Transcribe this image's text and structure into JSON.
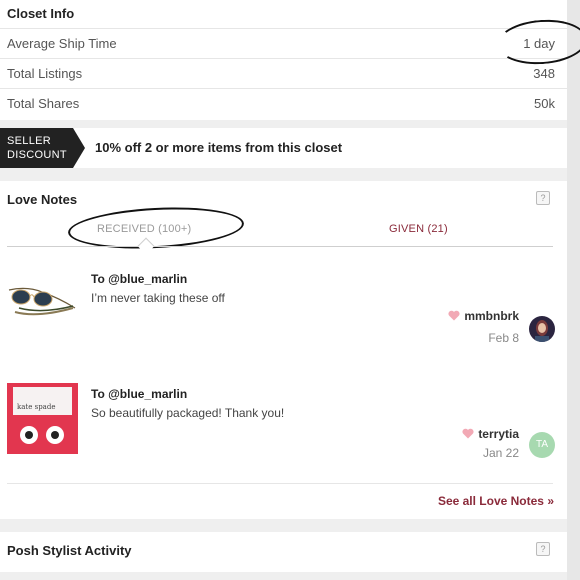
{
  "closet_info": {
    "title": "Closet Info",
    "rows": [
      {
        "label": "Average Ship Time",
        "value": "1 day"
      },
      {
        "label": "Total Listings",
        "value": "348"
      },
      {
        "label": "Total Shares",
        "value": "50k"
      }
    ]
  },
  "discount": {
    "badge_line1": "SELLER",
    "badge_line2": "DISCOUNT",
    "text": "10% off 2 or more items from this closet"
  },
  "love_notes": {
    "title": "Love Notes",
    "help": "?",
    "tabs": [
      {
        "label": "RECEIVED (100+)",
        "active": true
      },
      {
        "label": "GIVEN (21)",
        "active": false
      }
    ],
    "notes": [
      {
        "to": "To @blue_marlin",
        "message": "I’m never taking these off",
        "user": "mmbnbrk",
        "date": "Feb 8",
        "thumb_icon": "sunglasses-thumbnail"
      },
      {
        "to": "To @blue_marlin",
        "message": "So beautifully packaged! Thank you!",
        "user": "terrytia",
        "date": "Jan 22",
        "avatar_initials": "TA",
        "thumb_icon": "earrings-thumbnail"
      }
    ],
    "see_all": "See all Love Notes »"
  },
  "posh_stylist": {
    "title": "Posh Stylist Activity",
    "help": "?"
  },
  "colors": {
    "accent": "#8a2a3a",
    "heart": "#f2a9b5",
    "avatar_ta": "#a7d9b0"
  }
}
